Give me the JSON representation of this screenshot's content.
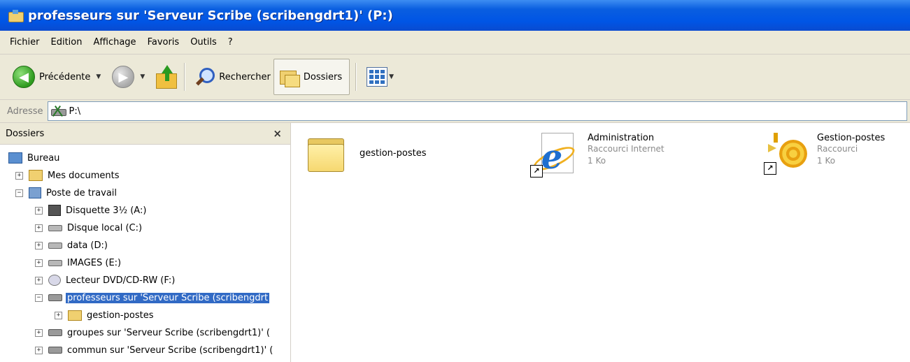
{
  "window": {
    "title": "professeurs sur 'Serveur Scribe (scribengdrt1)' (P:)"
  },
  "menu": [
    "Fichier",
    "Edition",
    "Affichage",
    "Favoris",
    "Outils",
    "?"
  ],
  "toolbar": {
    "back_label": "Précédente",
    "search_label": "Rechercher",
    "folders_label": "Dossiers"
  },
  "address": {
    "label": "Adresse",
    "value": "P:\\"
  },
  "folder_pane": {
    "title": "Dossiers",
    "close": "×",
    "tree": [
      {
        "label": "Bureau",
        "icon": "desktop-icon"
      },
      {
        "label": "Mes documents",
        "icon": "my-documents-icon",
        "expander": "+"
      },
      {
        "label": "Poste de travail",
        "icon": "computer-icon",
        "expander": "−"
      },
      {
        "label": "Disquette 3½ (A:)",
        "icon": "floppy-icon",
        "expander": "+"
      },
      {
        "label": "Disque local (C:)",
        "icon": "hard-drive-icon",
        "expander": "+"
      },
      {
        "label": "data (D:)",
        "icon": "hard-drive-icon",
        "expander": "+"
      },
      {
        "label": "IMAGES (E:)",
        "icon": "hard-drive-icon",
        "expander": "+"
      },
      {
        "label": "Lecteur DVD/CD-RW (F:)",
        "icon": "dvd-drive-icon",
        "expander": "+"
      },
      {
        "label": "professeurs sur 'Serveur Scribe (scribengdrt",
        "icon": "network-drive-icon",
        "expander": "−",
        "selected": true
      },
      {
        "label": "gestion-postes",
        "icon": "folder-icon",
        "expander": "+"
      },
      {
        "label": "groupes sur 'Serveur Scribe (scribengdrt1)' (",
        "icon": "network-drive-icon",
        "expander": "+"
      },
      {
        "label": "commun sur 'Serveur Scribe (scribengdrt1)' (",
        "icon": "network-drive-icon",
        "expander": "+"
      }
    ]
  },
  "content": {
    "items": [
      {
        "name": "gestion-postes",
        "icon": "folder-icon"
      },
      {
        "name": "Administration",
        "type": "Raccourci Internet",
        "size": "1 Ko",
        "icon": "internet-explorer-icon"
      },
      {
        "name": "Gestion-postes",
        "type": "Raccourci",
        "size": "1 Ko",
        "icon": "gestion-postes-icon"
      }
    ]
  },
  "colors": {
    "titlebar": "#0055e5",
    "selection": "#316ac5",
    "chrome": "#ece9d8"
  }
}
